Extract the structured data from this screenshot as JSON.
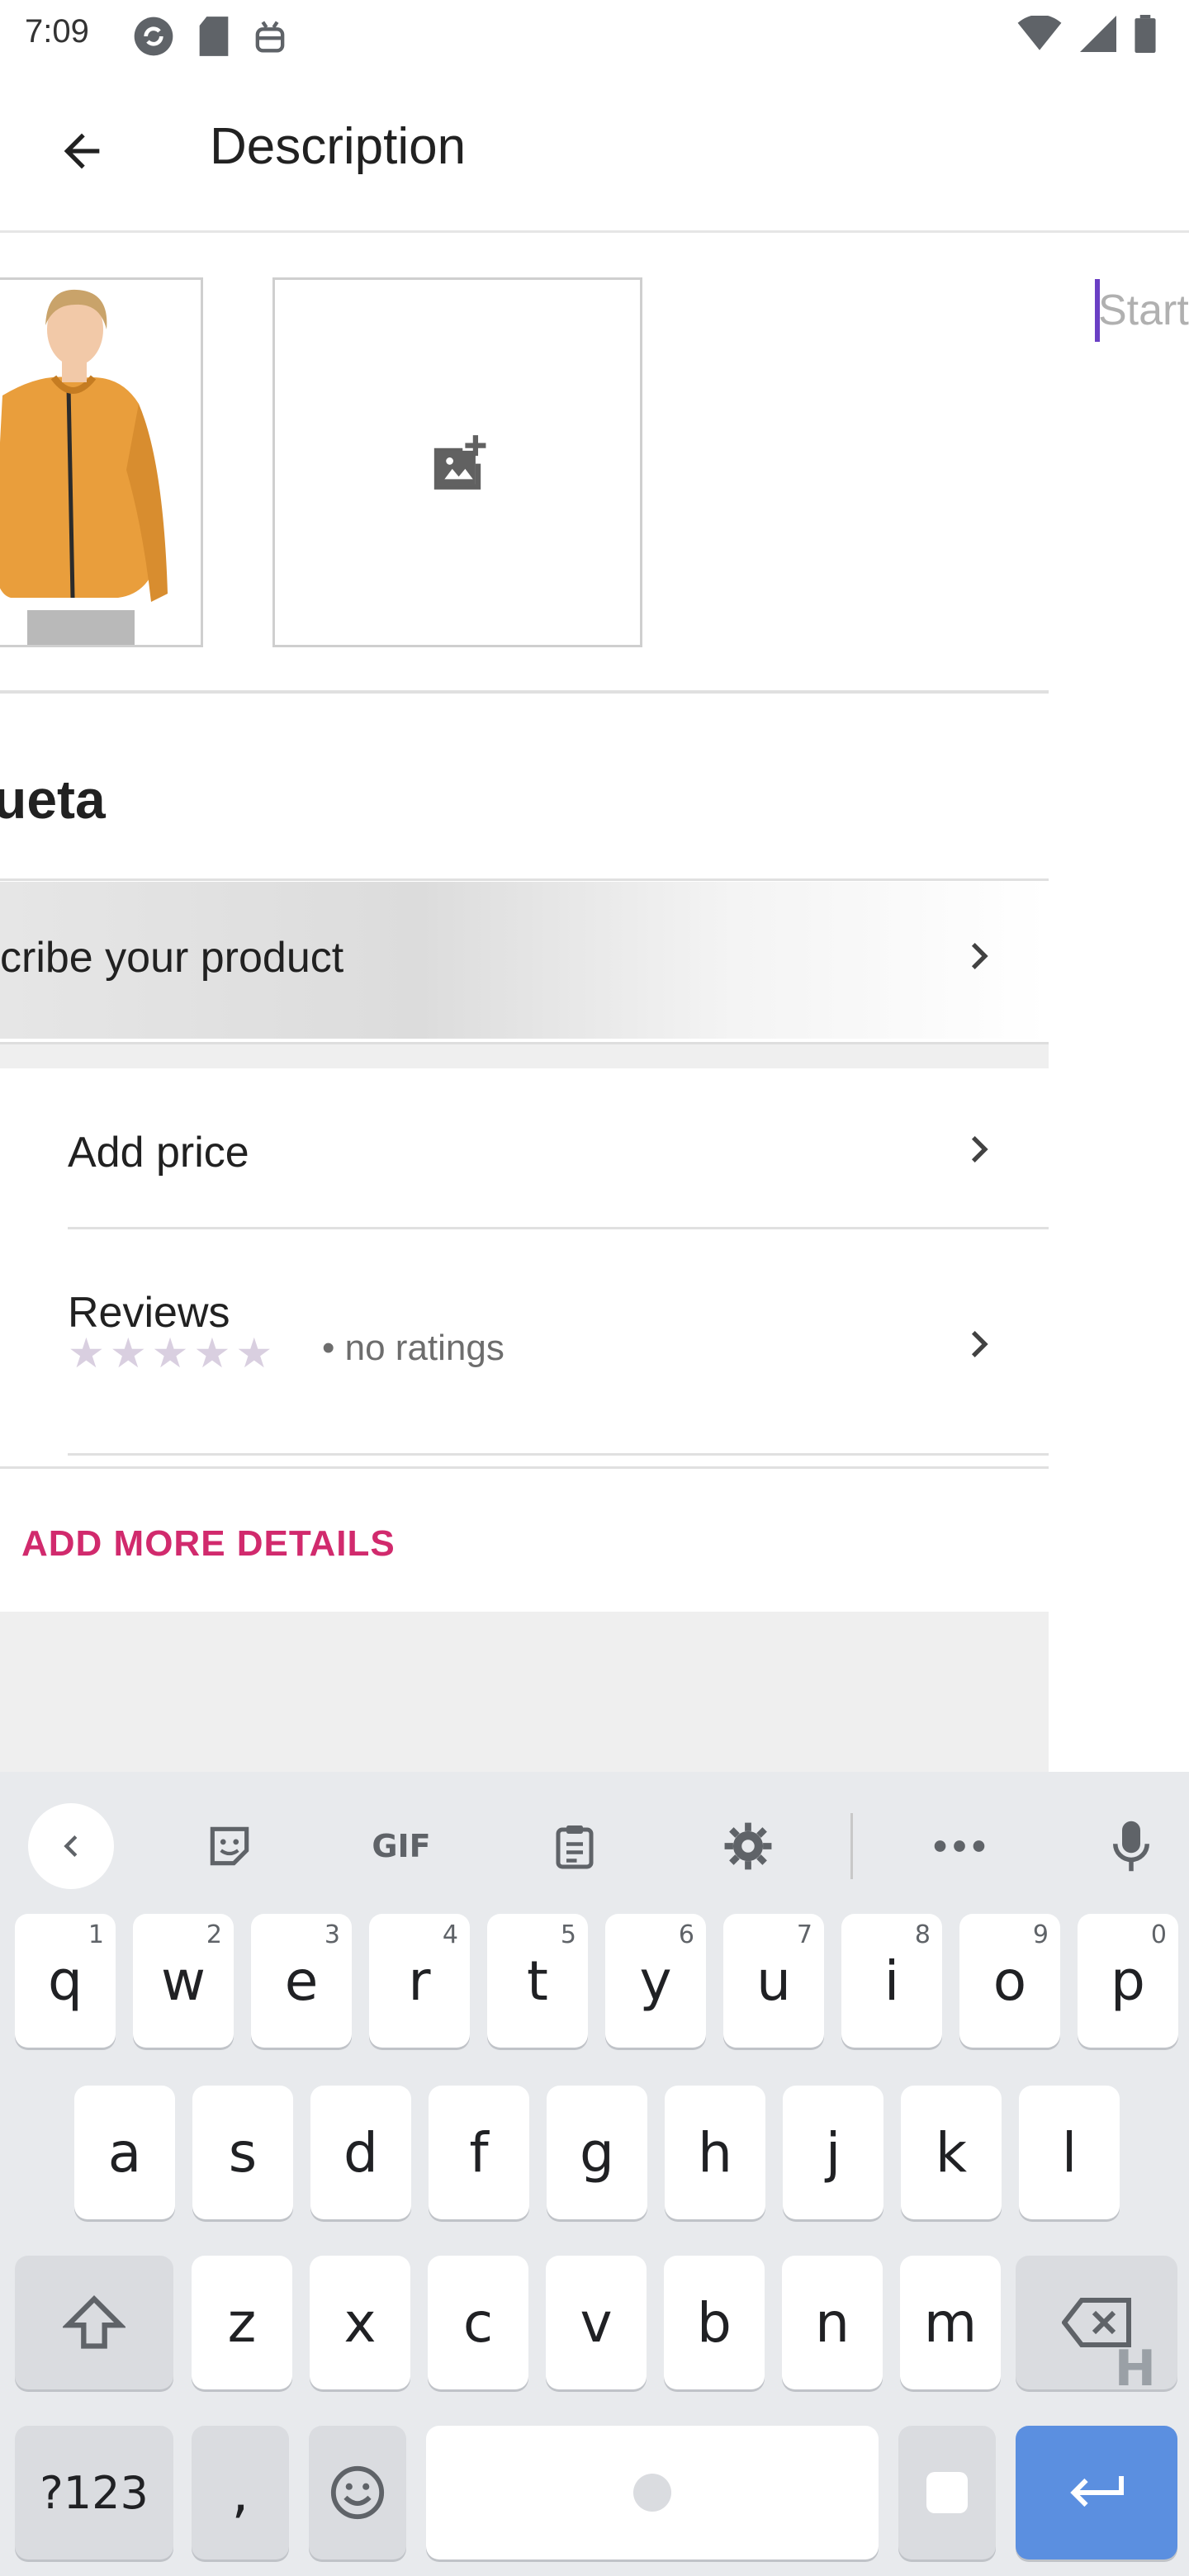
{
  "status_bar": {
    "time": "7:09",
    "left_icons": [
      "sync-icon",
      "sd-card-icon",
      "android-debug-icon"
    ],
    "right_icons": [
      "wifi-icon",
      "signal-icon",
      "battery-icon"
    ]
  },
  "app_bar": {
    "back_icon": "arrow-back-icon",
    "title": "Description"
  },
  "media": {
    "add_photo_icon": "add-photo-icon"
  },
  "editor": {
    "placeholder": "Start"
  },
  "product": {
    "name": "ueta"
  },
  "rows": {
    "describe_label": "cribe your product",
    "price_label": "Add price",
    "reviews_label": "Reviews",
    "reviews_rating_text": "• no ratings",
    "star_count": 5
  },
  "more_details": {
    "label": "ADD MORE DETAILS"
  },
  "keyboard": {
    "toolbar_icons": [
      "chevron-left-icon",
      "sticker-icon",
      "gif-icon",
      "clipboard-icon",
      "settings-icon",
      "more-icon",
      "mic-icon"
    ],
    "toolbar_gif_label": "GIF",
    "row1": [
      "q",
      "w",
      "e",
      "r",
      "t",
      "y",
      "u",
      "i",
      "o",
      "p"
    ],
    "row1_hints": [
      "1",
      "2",
      "3",
      "4",
      "5",
      "6",
      "7",
      "8",
      "9",
      "0"
    ],
    "row2": [
      "a",
      "s",
      "d",
      "f",
      "g",
      "h",
      "j",
      "k",
      "l"
    ],
    "row3": [
      "z",
      "x",
      "c",
      "v",
      "b",
      "n",
      "m"
    ],
    "symbols_label": "?123",
    "comma_label": ",",
    "overlay_letter": "H"
  }
}
